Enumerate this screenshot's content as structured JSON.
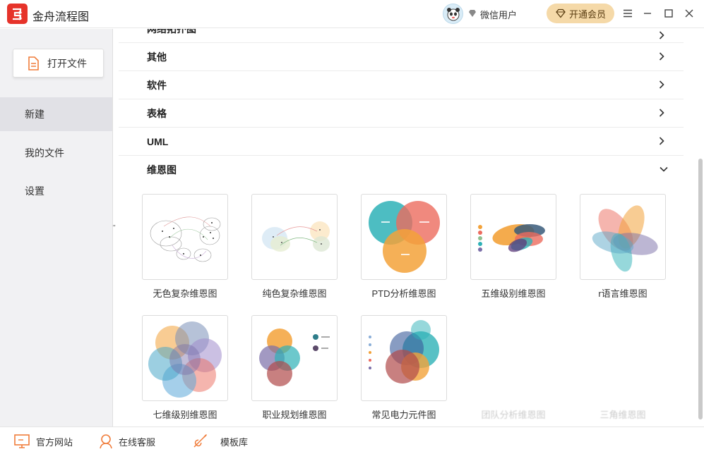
{
  "app": {
    "title": "金舟流程图"
  },
  "user": {
    "name": "微信用户",
    "vip_label": "开通会员"
  },
  "sidebar": {
    "open_label": "打开文件",
    "items": [
      {
        "label": "新建",
        "active": true
      },
      {
        "label": "我的文件",
        "active": false
      },
      {
        "label": "设置",
        "active": false
      }
    ],
    "collapse_glyph": "\""
  },
  "categories": {
    "partial_label": "网络拓扑图",
    "rows": [
      {
        "label": "其他",
        "expanded": false
      },
      {
        "label": "软件",
        "expanded": false
      },
      {
        "label": "表格",
        "expanded": false
      },
      {
        "label": "UML",
        "expanded": false
      },
      {
        "label": "维恩图",
        "expanded": true
      }
    ]
  },
  "templates": [
    {
      "label": "无色复杂维恩图"
    },
    {
      "label": "纯色复杂维恩图"
    },
    {
      "label": "PTD分析维恩图"
    },
    {
      "label": "五维级别维恩图"
    },
    {
      "label": "r语言维恩图"
    },
    {
      "label": "七维级别维恩图"
    },
    {
      "label": "职业规划维恩图"
    },
    {
      "label": "常见电力元件图"
    },
    {
      "label": "团队分析维恩图"
    },
    {
      "label": "三角维恩图"
    }
  ],
  "bottom": {
    "website": "官方网站",
    "support": "在线客服",
    "library": "模板库"
  },
  "colors": {
    "brand_red": "#e6332a",
    "vip_gold": "#f5d9a8",
    "sidebar_bg": "#f1f1f3",
    "sidebar_active": "#e1e1e6"
  },
  "icons": {
    "logo": "flowchart-logo-icon",
    "avatar": "panda-avatar-icon",
    "vip": "diamond-icon",
    "menu": "hamburger-icon",
    "minimize": "minimize-icon",
    "maximize": "maximize-icon",
    "close": "close-icon"
  }
}
